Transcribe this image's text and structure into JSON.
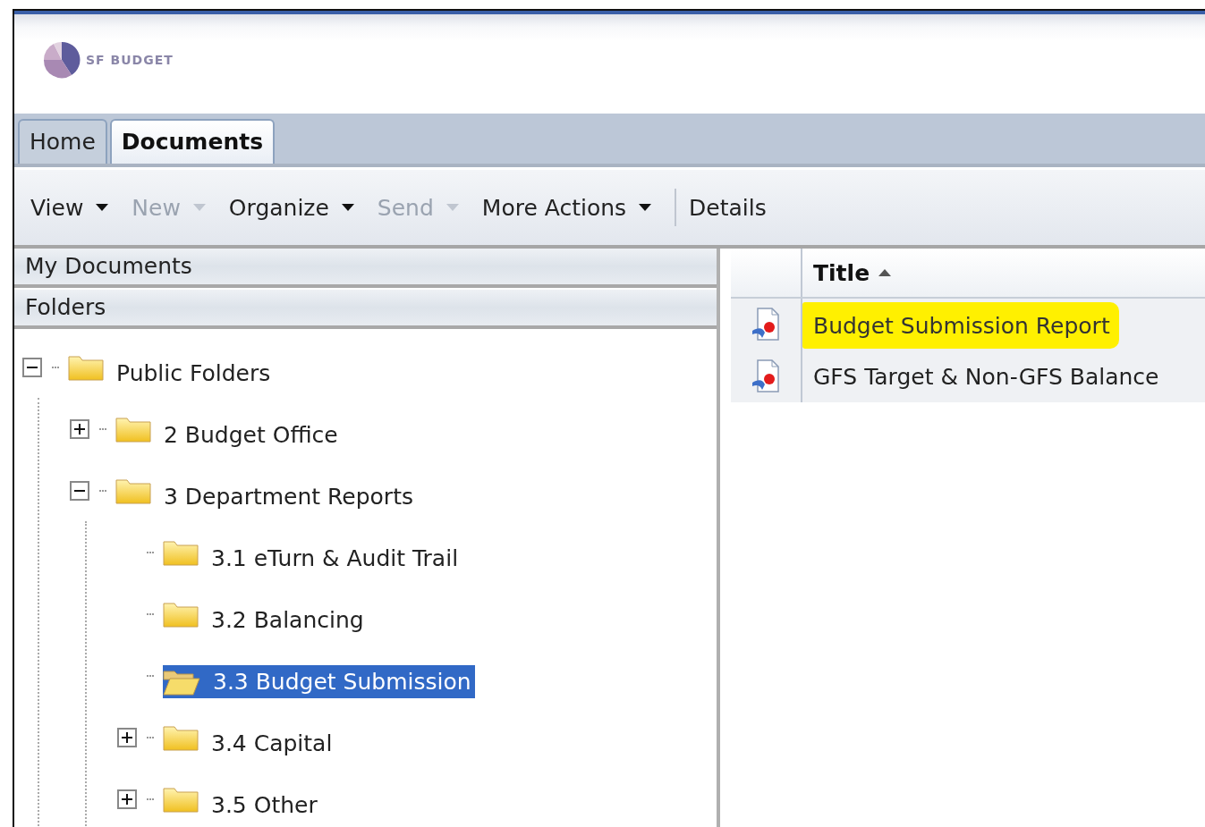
{
  "logo": {
    "text": "SF BUDGET"
  },
  "tabs": [
    {
      "label": "Home",
      "selected": false
    },
    {
      "label": "Documents",
      "selected": true
    }
  ],
  "toolbar": [
    {
      "kind": "menu",
      "label": "View",
      "disabled": false
    },
    {
      "kind": "menu",
      "label": "New",
      "disabled": true
    },
    {
      "kind": "menu",
      "label": "Organize",
      "disabled": false
    },
    {
      "kind": "menu",
      "label": "Send",
      "disabled": true
    },
    {
      "kind": "menu",
      "label": "More Actions",
      "disabled": false
    },
    {
      "kind": "separator"
    },
    {
      "kind": "button",
      "label": "Details",
      "disabled": false
    }
  ],
  "sidebar": {
    "sections": [
      "My Documents",
      "Folders"
    ],
    "tree": [
      {
        "label": "Public Folders",
        "expanded": true,
        "selected": false,
        "children": [
          {
            "label": "2 Budget Office",
            "expanded": false,
            "selected": false
          },
          {
            "label": "3 Department Reports",
            "expanded": true,
            "selected": false,
            "children": [
              {
                "label": "3.1 eTurn & Audit Trail",
                "selected": false
              },
              {
                "label": "3.2 Balancing",
                "selected": false
              },
              {
                "label": "3.3 Budget Submission",
                "selected": true
              },
              {
                "label": "3.4 Capital",
                "expanded": false,
                "selected": false
              },
              {
                "label": "3.5 Other",
                "expanded": false,
                "selected": false
              }
            ]
          }
        ]
      }
    ]
  },
  "table": {
    "columns": [
      {
        "label": "Title",
        "sort_ascending": true
      }
    ],
    "rows": [
      {
        "title": "Budget Submission Report",
        "highlighted": true
      },
      {
        "title": "GFS Target & Non-GFS Balance",
        "highlighted": false
      }
    ]
  }
}
